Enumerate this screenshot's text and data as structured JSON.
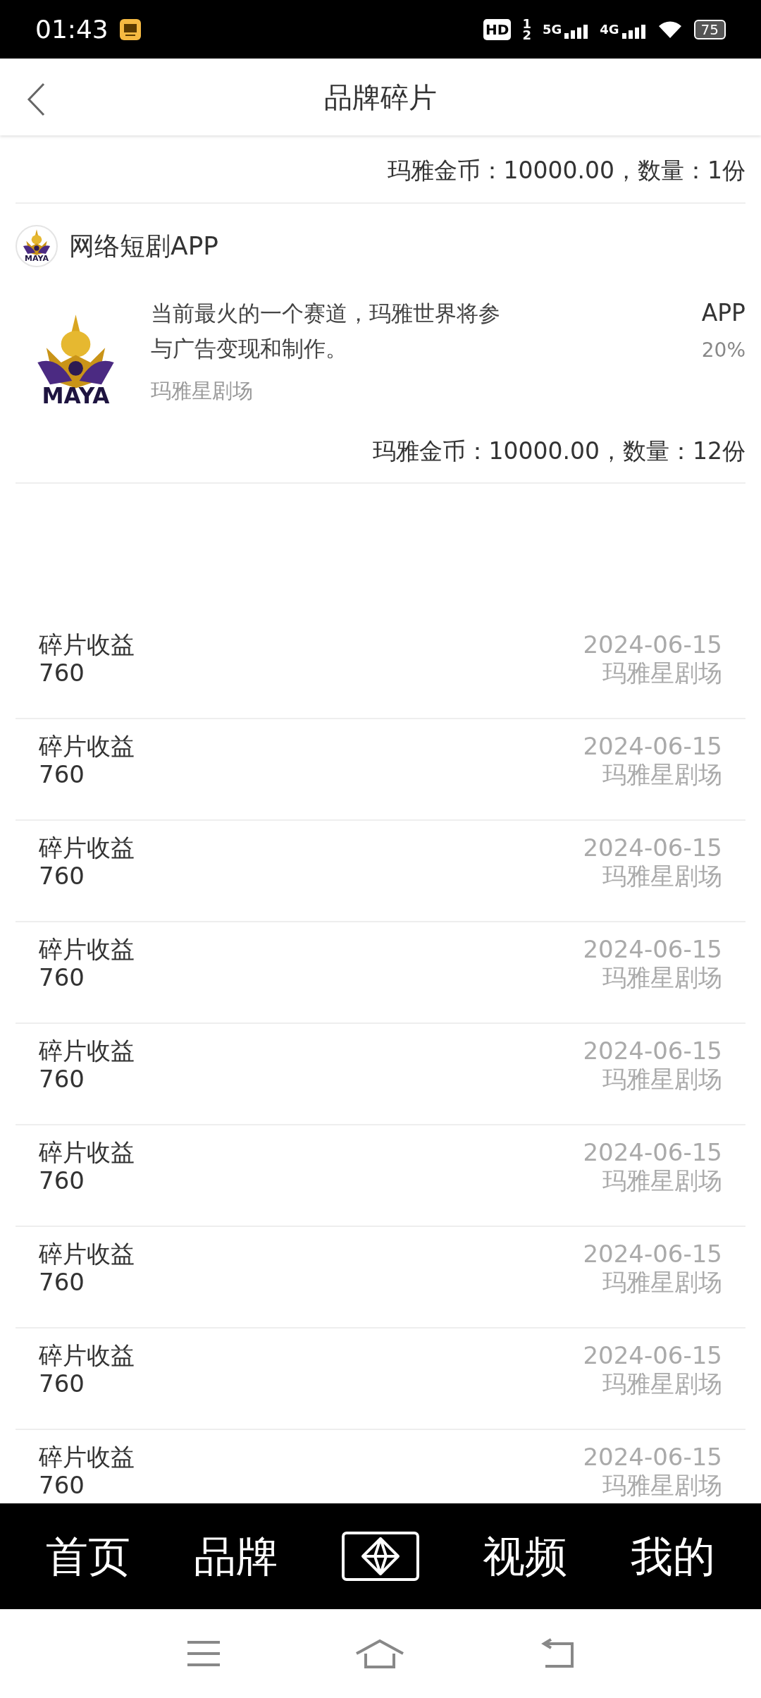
{
  "status_bar": {
    "time": "01:43",
    "hd": "HD",
    "sim_marks": [
      "1",
      "2"
    ],
    "networks": [
      "5G",
      "4G"
    ],
    "battery": "75"
  },
  "header": {
    "title": "品牌碎片"
  },
  "summary_top": "玛雅金币：10000.00，数量：1份",
  "brand": {
    "avatar_text": "MAYA",
    "name": "网络短剧APP"
  },
  "product": {
    "logo_text": "MAYA",
    "description": "当前最火的一个赛道，玛雅世界将参与广告变现和制作。",
    "source": "玛雅星剧场",
    "type": "APP",
    "share": "20%",
    "summary": "玛雅金币：10000.00，数量：12份"
  },
  "records": [
    {
      "label": "碎片收益",
      "amount": "760",
      "date": "2024-06-15",
      "source": "玛雅星剧场"
    },
    {
      "label": "碎片收益",
      "amount": "760",
      "date": "2024-06-15",
      "source": "玛雅星剧场"
    },
    {
      "label": "碎片收益",
      "amount": "760",
      "date": "2024-06-15",
      "source": "玛雅星剧场"
    },
    {
      "label": "碎片收益",
      "amount": "760",
      "date": "2024-06-15",
      "source": "玛雅星剧场"
    },
    {
      "label": "碎片收益",
      "amount": "760",
      "date": "2024-06-15",
      "source": "玛雅星剧场"
    },
    {
      "label": "碎片收益",
      "amount": "760",
      "date": "2024-06-15",
      "source": "玛雅星剧场"
    },
    {
      "label": "碎片收益",
      "amount": "760",
      "date": "2024-06-15",
      "source": "玛雅星剧场"
    },
    {
      "label": "碎片收益",
      "amount": "760",
      "date": "2024-06-15",
      "source": "玛雅星剧场"
    },
    {
      "label": "碎片收益",
      "amount": "760",
      "date": "2024-06-15",
      "source": "玛雅星剧场"
    }
  ],
  "bottom_nav": [
    {
      "kind": "text",
      "label": "首页"
    },
    {
      "kind": "text",
      "label": "品牌"
    },
    {
      "kind": "icon"
    },
    {
      "kind": "text",
      "label": "视频"
    },
    {
      "kind": "text",
      "label": "我的"
    }
  ]
}
